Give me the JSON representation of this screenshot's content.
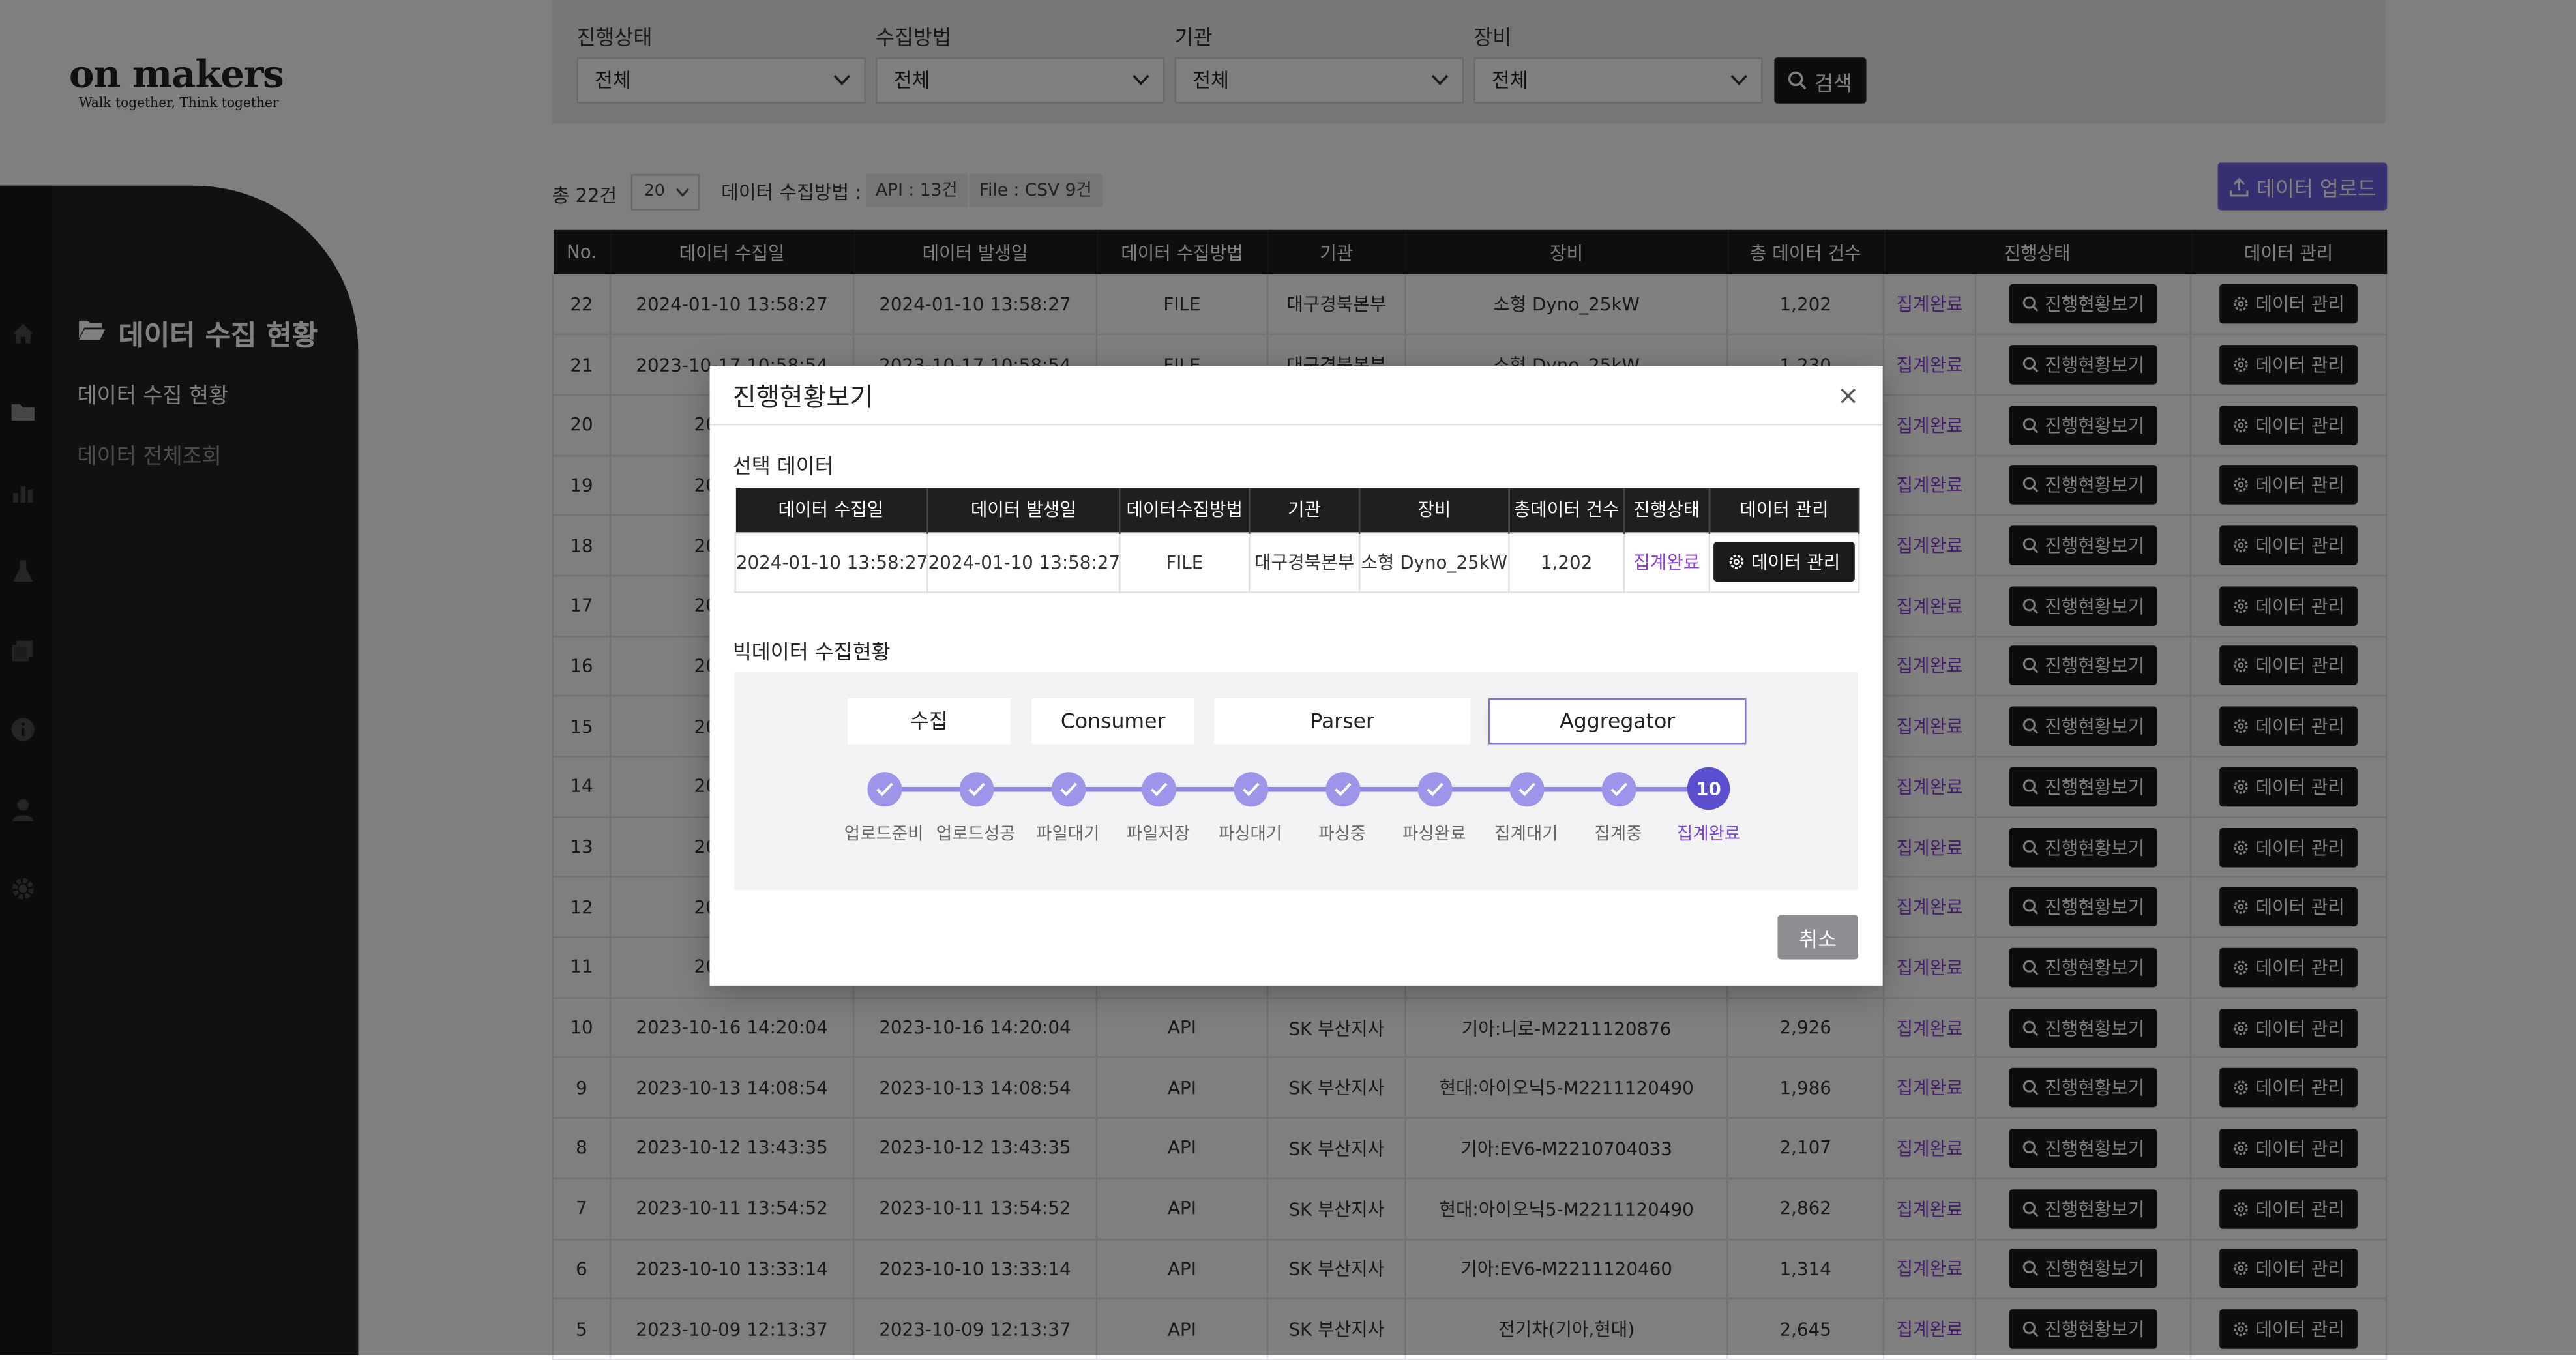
{
  "brand": {
    "logo_text": "on makers",
    "tagline": "Walk together, Think together",
    "accent_color": "#e0463a"
  },
  "sidebar": {
    "title": "데이터 수집 현황",
    "items": [
      "데이터 수집 현황",
      "데이터 전체조회"
    ]
  },
  "filters": [
    {
      "label": "진행상태",
      "value": "전체"
    },
    {
      "label": "수집방법",
      "value": "전체"
    },
    {
      "label": "기관",
      "value": "전체"
    },
    {
      "label": "장비",
      "value": "전체"
    }
  ],
  "search_label": "검색",
  "summary": {
    "total": "총 22건",
    "page_size": "20",
    "method_label": "데이터 수집방법 :",
    "api_chip": "API : 13건",
    "file_chip": "File : CSV 9건",
    "upload_label": "데이터 업로드"
  },
  "table": {
    "headers": [
      "No.",
      "데이터 수집일",
      "데이터 발생일",
      "데이터 수집방법",
      "기관",
      "장비",
      "총 데이터 건수",
      "진행상태",
      "",
      "데이터 관리"
    ],
    "progress_header": "진행상태",
    "rows": [
      [
        "22",
        "2024-01-10 13:58:27",
        "2024-01-10 13:58:27",
        "FILE",
        "대구경북본부",
        "소형 Dyno_25kW",
        "1,202",
        "집계완료"
      ],
      [
        "21",
        "2023-10-17 10:58:54",
        "2023-10-17 10:58:54",
        "FILE",
        "대구경북본부",
        "소형 Dyno_25kW",
        "1,230",
        "집계완료"
      ],
      [
        "20",
        "2023-10",
        "",
        "",
        "",
        "",
        "",
        "집계완료"
      ],
      [
        "19",
        "2023-10",
        "",
        "",
        "",
        "",
        "",
        "집계완료"
      ],
      [
        "18",
        "2023-10",
        "",
        "",
        "",
        "",
        "",
        "집계완료"
      ],
      [
        "17",
        "2023-10",
        "",
        "",
        "",
        "",
        "",
        "집계완료"
      ],
      [
        "16",
        "2023-10",
        "",
        "",
        "",
        "",
        "",
        "집계완료"
      ],
      [
        "15",
        "2023-10",
        "",
        "",
        "",
        "",
        "",
        "집계완료"
      ],
      [
        "14",
        "2023-10",
        "",
        "",
        "",
        "",
        "",
        "집계완료"
      ],
      [
        "13",
        "2023-10",
        "",
        "",
        "",
        "",
        "",
        "집계완료"
      ],
      [
        "12",
        "2023-10",
        "",
        "",
        "",
        "",
        "",
        "집계완료"
      ],
      [
        "11",
        "2023-10",
        "",
        "",
        "",
        "",
        "",
        "집계완료"
      ],
      [
        "10",
        "2023-10-16 14:20:04",
        "2023-10-16 14:20:04",
        "API",
        "SK 부산지사",
        "기아:니로-M2211120876",
        "2,926",
        "집계완료"
      ],
      [
        "9",
        "2023-10-13 14:08:54",
        "2023-10-13 14:08:54",
        "API",
        "SK 부산지사",
        "현대:아이오닉5-M2211120490",
        "1,986",
        "집계완료"
      ],
      [
        "8",
        "2023-10-12 13:43:35",
        "2023-10-12 13:43:35",
        "API",
        "SK 부산지사",
        "기아:EV6-M2210704033",
        "2,107",
        "집계완료"
      ],
      [
        "7",
        "2023-10-11 13:54:52",
        "2023-10-11 13:54:52",
        "API",
        "SK 부산지사",
        "현대:아이오닉5-M2211120490",
        "2,862",
        "집계완료"
      ],
      [
        "6",
        "2023-10-10 13:33:14",
        "2023-10-10 13:33:14",
        "API",
        "SK 부산지사",
        "기아:EV6-M2211120460",
        "1,314",
        "집계완료"
      ],
      [
        "5",
        "2023-10-09 12:13:37",
        "2023-10-09 12:13:37",
        "API",
        "SK 부산지사",
        "전기차(기아,현대)",
        "2,645",
        "집계완료"
      ]
    ],
    "view_button": "진행현황보기",
    "manage_button": "데이터 관리",
    "status_color": "#8a3ad6"
  },
  "modal": {
    "title": "진행현황보기",
    "selected_label": "선택 데이터",
    "selected_headers": [
      "데이터 수집일",
      "데이터 발생일",
      "데이터수집방법",
      "기관",
      "장비",
      "총데이터 건수",
      "진행상태",
      "데이터 관리"
    ],
    "selected_row": [
      "2024-01-10 13:58:27",
      "2024-01-10 13:58:27",
      "FILE",
      "대구경북본부",
      "소형 Dyno_25kW",
      "1,202",
      "집계완료"
    ],
    "manage_button": "데이터 관리",
    "bigdata_label": "빅데이터 수집현황",
    "stages": [
      "수집",
      "Consumer",
      "Parser",
      "Aggregator"
    ],
    "active_stage": "Aggregator",
    "steps": [
      "업로드준비",
      "업로드성공",
      "파일대기",
      "파일저장",
      "파싱대기",
      "파싱중",
      "파싱완료",
      "집계대기",
      "집계중",
      "집계완료"
    ],
    "current_step_number": "10",
    "current_step_index": 9,
    "cancel_label": "취소",
    "accent_color": "#5b4fcf"
  }
}
